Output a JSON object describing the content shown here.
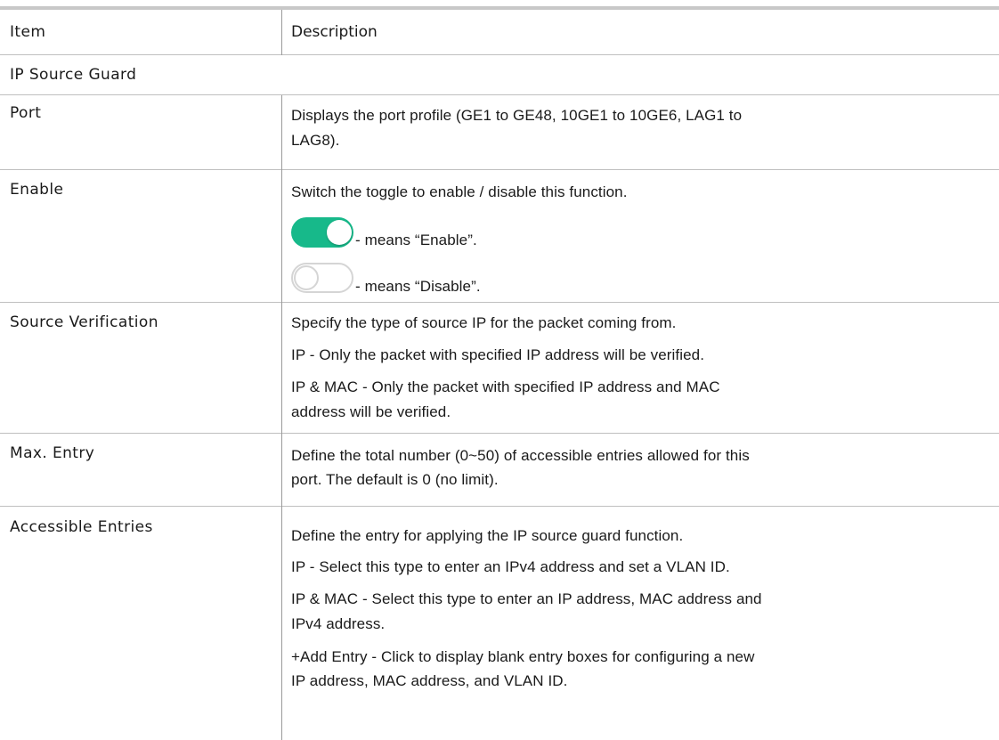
{
  "header": {
    "item": "Item",
    "description": "Description"
  },
  "section": "IP Source Guard",
  "rows": {
    "port": {
      "item": "Port",
      "lines": [
        "Displays the port profile (GE1 to GE48, 10GE1 to 10GE6, LAG1 to",
        "LAG8)."
      ]
    },
    "enable": {
      "item": "Enable",
      "line1": "Switch the toggle to enable / disable this function.",
      "on_text": "- means “Enable”.",
      "off_text": "- means “Disable”."
    },
    "source_verification": {
      "item": "Source Verification",
      "lines": [
        "Specify the type of source IP for the packet coming from.",
        "IP - Only the packet with specified IP address will be verified.",
        "IP & MAC - Only the packet with specified IP address and MAC",
        "address will be verified."
      ]
    },
    "max_entry": {
      "item": "Max. Entry",
      "lines": [
        "Define the total number (0~50) of accessible entries allowed for this",
        "port. The default is 0 (no limit)."
      ]
    },
    "accessible_entries": {
      "item": "Accessible Entries",
      "lines": [
        "Define the entry for applying the IP source guard function.",
        "IP - Select this type to enter an IPv4 address and set a VLAN ID.",
        "IP & MAC - Select this type to enter an IP address, MAC address and",
        "IPv4 address.",
        "+Add Entry - Click to display blank entry boxes for configuring a new",
        "IP address, MAC address, and VLAN ID."
      ]
    }
  },
  "colors": {
    "toggle_on": "#17b98a",
    "toggle_off_border": "#d5d5d5"
  },
  "icons": {
    "on": "toggle-on-icon",
    "off": "toggle-off-icon"
  }
}
